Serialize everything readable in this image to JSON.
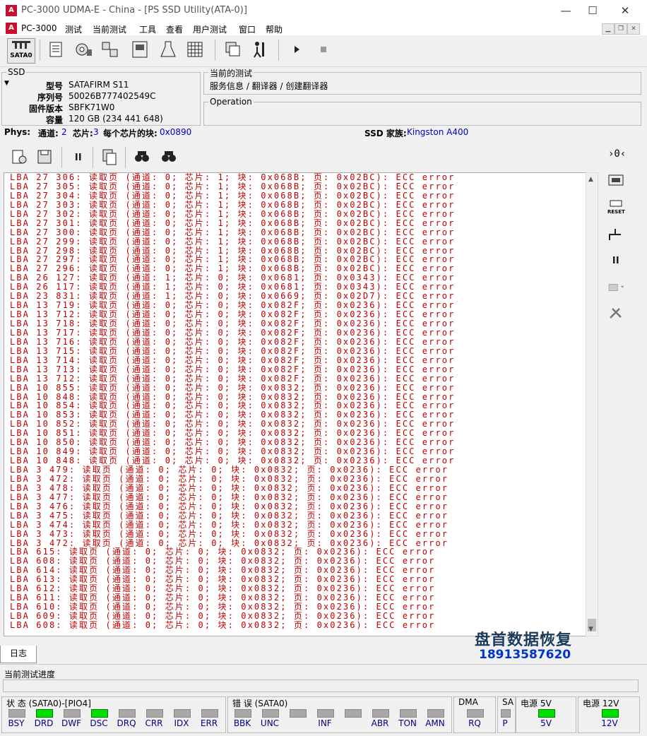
{
  "window": {
    "title": "PC-3000 UDMA-E - China - [PS SSD Utility(ATA-0)]",
    "logo": "A",
    "minimize": "—",
    "maximize": "☐",
    "close": "✕"
  },
  "menu": {
    "items": [
      "PC-3000",
      "测试",
      "当前测试",
      "工具",
      "查看",
      "用户测试",
      "窗口",
      "帮助"
    ]
  },
  "toolbar": {
    "sata_label": "SATA0"
  },
  "ssd_panel": {
    "legend": "SSD",
    "model_label": "型号",
    "model_value": "SATAFIRM   S11",
    "serial_label": "序列号",
    "serial_value": "50026B777402549C",
    "firmware_label": "固件版本",
    "firmware_value": "SBFK71W0",
    "capacity_label": "容量",
    "capacity_value": "120 GB (234 441 648)"
  },
  "current_test": {
    "legend": "当前的测试",
    "path": "服务信息 / 翻译器 / 创建翻译器"
  },
  "operation": {
    "legend": "Operation"
  },
  "phys": {
    "label": "Phys:",
    "channel_label": "通道:",
    "channel_value": "2",
    "chip_label": "芯片:",
    "chip_value": "3",
    "blocks_label": "每个芯片的块:",
    "blocks_value": "0x0890",
    "family_label": "SSD 家族:",
    "family_value": "Kingston A400"
  },
  "log_lines": [
    "LBA 27 306: 读取页 (通道: 0; 芯片: 1; 块: 0x068B; 页: 0x02BC): ECC error",
    "LBA 27 305: 读取页 (通道: 0; 芯片: 1; 块: 0x068B; 页: 0x02BC): ECC error",
    "LBA 27 304: 读取页 (通道: 0; 芯片: 1; 块: 0x068B; 页: 0x02BC): ECC error",
    "LBA 27 303: 读取页 (通道: 0; 芯片: 1; 块: 0x068B; 页: 0x02BC): ECC error",
    "LBA 27 302: 读取页 (通道: 0; 芯片: 1; 块: 0x068B; 页: 0x02BC): ECC error",
    "LBA 27 301: 读取页 (通道: 0; 芯片: 1; 块: 0x068B; 页: 0x02BC): ECC error",
    "LBA 27 300: 读取页 (通道: 0; 芯片: 1; 块: 0x068B; 页: 0x02BC): ECC error",
    "LBA 27 299: 读取页 (通道: 0; 芯片: 1; 块: 0x068B; 页: 0x02BC): ECC error",
    "LBA 27 298: 读取页 (通道: 0; 芯片: 1; 块: 0x068B; 页: 0x02BC): ECC error",
    "LBA 27 297: 读取页 (通道: 0; 芯片: 1; 块: 0x068B; 页: 0x02BC): ECC error",
    "LBA 27 296: 读取页 (通道: 0; 芯片: 1; 块: 0x068B; 页: 0x02BC): ECC error",
    "LBA 26 127: 读取页 (通道: 1; 芯片: 0; 块: 0x0681; 页: 0x0343): ECC error",
    "LBA 26 117: 读取页 (通道: 1; 芯片: 0; 块: 0x0681; 页: 0x0343): ECC error",
    "LBA 23 831: 读取页 (通道: 1; 芯片: 0; 块: 0x0669; 页: 0x02D7): ECC error",
    "LBA 13 719: 读取页 (通道: 0; 芯片: 0; 块: 0x082F; 页: 0x0236): ECC error",
    "LBA 13 712: 读取页 (通道: 0; 芯片: 0; 块: 0x082F; 页: 0x0236): ECC error",
    "LBA 13 718: 读取页 (通道: 0; 芯片: 0; 块: 0x082F; 页: 0x0236): ECC error",
    "LBA 13 717: 读取页 (通道: 0; 芯片: 0; 块: 0x082F; 页: 0x0236): ECC error",
    "LBA 13 716: 读取页 (通道: 0; 芯片: 0; 块: 0x082F; 页: 0x0236): ECC error",
    "LBA 13 715: 读取页 (通道: 0; 芯片: 0; 块: 0x082F; 页: 0x0236): ECC error",
    "LBA 13 714: 读取页 (通道: 0; 芯片: 0; 块: 0x082F; 页: 0x0236): ECC error",
    "LBA 13 713: 读取页 (通道: 0; 芯片: 0; 块: 0x082F; 页: 0x0236): ECC error",
    "LBA 13 712: 读取页 (通道: 0; 芯片: 0; 块: 0x082F; 页: 0x0236): ECC error",
    "LBA 10 855: 读取页 (通道: 0; 芯片: 0; 块: 0x0832; 页: 0x0236): ECC error",
    "LBA 10 848: 读取页 (通道: 0; 芯片: 0; 块: 0x0832; 页: 0x0236): ECC error",
    "LBA 10 854: 读取页 (通道: 0; 芯片: 0; 块: 0x0832; 页: 0x0236): ECC error",
    "LBA 10 853: 读取页 (通道: 0; 芯片: 0; 块: 0x0832; 页: 0x0236): ECC error",
    "LBA 10 852: 读取页 (通道: 0; 芯片: 0; 块: 0x0832; 页: 0x0236): ECC error",
    "LBA 10 851: 读取页 (通道: 0; 芯片: 0; 块: 0x0832; 页: 0x0236): ECC error",
    "LBA 10 850: 读取页 (通道: 0; 芯片: 0; 块: 0x0832; 页: 0x0236): ECC error",
    "LBA 10 849: 读取页 (通道: 0; 芯片: 0; 块: 0x0832; 页: 0x0236): ECC error",
    "LBA 10 848: 读取页 (通道: 0; 芯片: 0; 块: 0x0832; 页: 0x0236): ECC error",
    "LBA 3 479: 读取页 (通道: 0; 芯片: 0; 块: 0x0832; 页: 0x0236): ECC error",
    "LBA 3 472: 读取页 (通道: 0; 芯片: 0; 块: 0x0832; 页: 0x0236): ECC error",
    "LBA 3 478: 读取页 (通道: 0; 芯片: 0; 块: 0x0832; 页: 0x0236): ECC error",
    "LBA 3 477: 读取页 (通道: 0; 芯片: 0; 块: 0x0832; 页: 0x0236): ECC error",
    "LBA 3 476: 读取页 (通道: 0; 芯片: 0; 块: 0x0832; 页: 0x0236): ECC error",
    "LBA 3 475: 读取页 (通道: 0; 芯片: 0; 块: 0x0832; 页: 0x0236): ECC error",
    "LBA 3 474: 读取页 (通道: 0; 芯片: 0; 块: 0x0832; 页: 0x0236): ECC error",
    "LBA 3 473: 读取页 (通道: 0; 芯片: 0; 块: 0x0832; 页: 0x0236): ECC error",
    "LBA 3 472: 读取页 (通道: 0; 芯片: 0; 块: 0x0832; 页: 0x0236): ECC error",
    "LBA 615: 读取页 (通道: 0; 芯片: 0; 块: 0x0832; 页: 0x0236): ECC error",
    "LBA 608: 读取页 (通道: 0; 芯片: 0; 块: 0x0832; 页: 0x0236): ECC error",
    "LBA 614: 读取页 (通道: 0; 芯片: 0; 块: 0x0832; 页: 0x0236): ECC error",
    "LBA 613: 读取页 (通道: 0; 芯片: 0; 块: 0x0832; 页: 0x0236): ECC error",
    "LBA 612: 读取页 (通道: 0; 芯片: 0; 块: 0x0832; 页: 0x0236): ECC error",
    "LBA 611: 读取页 (通道: 0; 芯片: 0; 块: 0x0832; 页: 0x0236): ECC error",
    "LBA 610: 读取页 (通道: 0; 芯片: 0; 块: 0x0832; 页: 0x0236): ECC error",
    "LBA 609: 读取页 (通道: 0; 芯片: 0; 块: 0x0832; 页: 0x0236): ECC error",
    "LBA 608: 读取页 (通道: 0; 芯片: 0; 块: 0x0832; 页: 0x0236): ECC error"
  ],
  "log_color": "#c00000",
  "tabs": {
    "log": "日志"
  },
  "progress": {
    "label": "当前测试进度"
  },
  "status": {
    "state_group": "状 态 (SATA0)-[PIO4]",
    "error_group": "错 误 (SATA0)",
    "dma_group": "DMA",
    "sa_group": "SA",
    "power5_group": "电源 5V",
    "power12_group": "电源 12V",
    "state_leds": [
      {
        "label": "BSY",
        "on": false
      },
      {
        "label": "DRD",
        "on": true
      },
      {
        "label": "DWF",
        "on": false
      },
      {
        "label": "DSC",
        "on": true
      },
      {
        "label": "DRQ",
        "on": false
      },
      {
        "label": "CRR",
        "on": false
      },
      {
        "label": "IDX",
        "on": false
      },
      {
        "label": "ERR",
        "on": false
      }
    ],
    "error_leds": [
      {
        "label": "BBK",
        "on": false
      },
      {
        "label": "UNC",
        "on": false
      },
      {
        "label": "",
        "on": false
      },
      {
        "label": "INF",
        "on": false
      },
      {
        "label": "",
        "on": false
      },
      {
        "label": "ABR",
        "on": false
      },
      {
        "label": "TON",
        "on": false
      },
      {
        "label": "AMN",
        "on": false
      }
    ],
    "dma_label": "RQ",
    "sa_label": "P",
    "power5_label": "5V",
    "power12_label": "12V"
  },
  "watermark": {
    "name": "盘首数据恢复",
    "phone": "18913587620"
  }
}
